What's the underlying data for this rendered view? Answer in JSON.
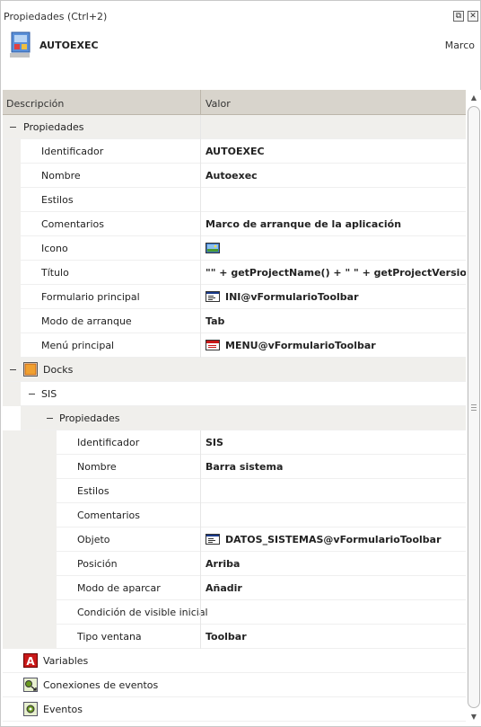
{
  "window": {
    "title": "Propiedades (Ctrl+2)",
    "restore_glyph": "⧉",
    "close_glyph": "✕"
  },
  "header": {
    "object_name": "AUTOEXEC",
    "object_type": "Marco",
    "icon": "form-frame-icon"
  },
  "table": {
    "col_description": "Descripción",
    "col_value": "Valor"
  },
  "groups": {
    "propiedades": "Propiedades",
    "docks": "Docks",
    "sis": "SIS",
    "sis_propiedades": "Propiedades",
    "variables": "Variables",
    "conexiones": "Conexiones de eventos",
    "eventos": "Eventos"
  },
  "properties": [
    {
      "name": "Identificador",
      "value": "AUTOEXEC",
      "icon": ""
    },
    {
      "name": "Nombre",
      "value": "Autoexec",
      "icon": ""
    },
    {
      "name": "Estilos",
      "value": "",
      "icon": ""
    },
    {
      "name": "Comentarios",
      "value": "Marco de arranque de la aplicación",
      "icon": ""
    },
    {
      "name": "Icono",
      "value": "",
      "icon": "image-icon"
    },
    {
      "name": "Título",
      "value": "\"\" + getProjectName() + \" \" +  getProjectVersion()",
      "icon": ""
    },
    {
      "name": "Formulario principal",
      "value": "INI@vFormularioToolbar",
      "icon": "form-icon"
    },
    {
      "name": "Modo de arranque",
      "value": "Tab",
      "icon": ""
    },
    {
      "name": "Menú principal",
      "value": "MENU@vFormularioToolbar",
      "icon": "menu-icon"
    }
  ],
  "sis_properties": [
    {
      "name": "Identificador",
      "value": "SIS",
      "icon": ""
    },
    {
      "name": "Nombre",
      "value": "Barra sistema",
      "icon": ""
    },
    {
      "name": "Estilos",
      "value": "",
      "icon": ""
    },
    {
      "name": "Comentarios",
      "value": "",
      "icon": ""
    },
    {
      "name": "Objeto",
      "value": "DATOS_SISTEMAS@vFormularioToolbar",
      "icon": "form-icon"
    },
    {
      "name": "Posición",
      "value": "Arriba",
      "icon": ""
    },
    {
      "name": "Modo de aparcar",
      "value": "Añadir",
      "icon": ""
    },
    {
      "name": "Condición de visible inicial",
      "value": "",
      "icon": ""
    },
    {
      "name": "Tipo ventana",
      "value": "Toolbar",
      "icon": ""
    }
  ],
  "scrollbar": {
    "up_glyph": "▲",
    "down_glyph": "▼"
  }
}
